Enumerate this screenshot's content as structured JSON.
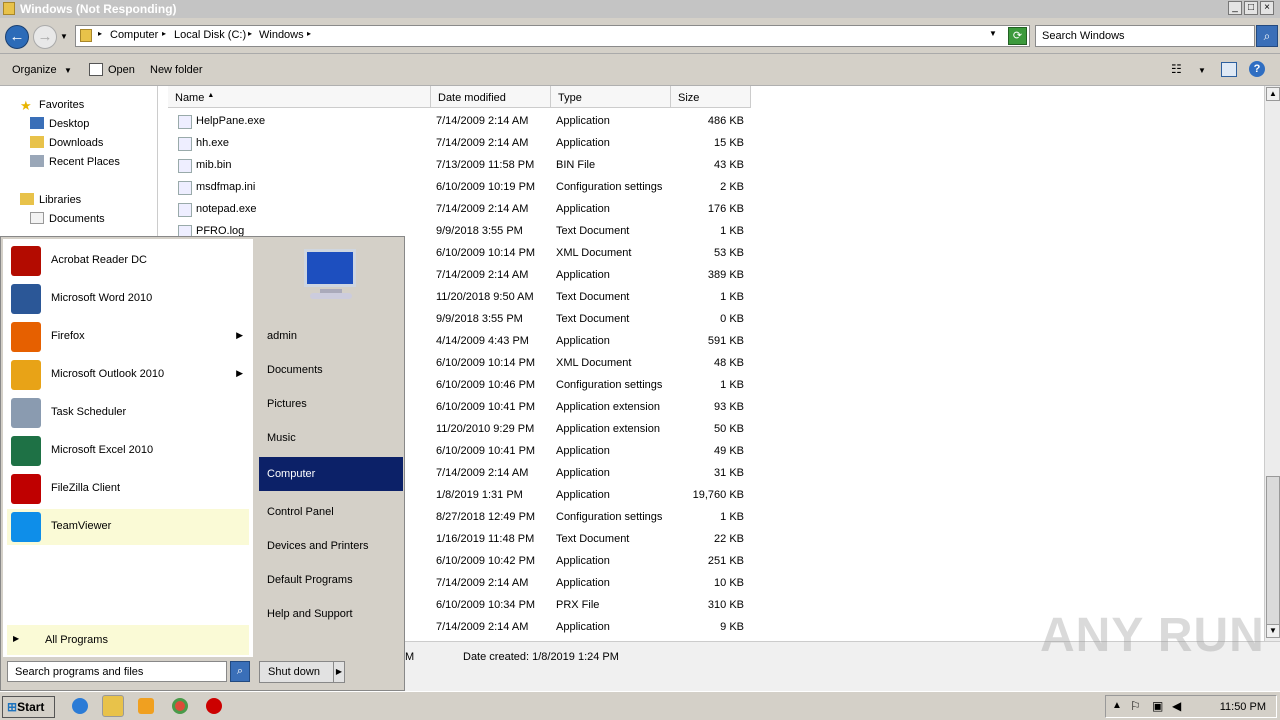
{
  "window": {
    "title": "Windows (Not Responding)",
    "min": "_",
    "max": "□",
    "close": "×"
  },
  "address": {
    "crumbs": [
      "Computer",
      "Local Disk (C:)",
      "Windows"
    ],
    "search_placeholder": "Search Windows"
  },
  "toolbar": {
    "organize": "Organize",
    "open": "Open",
    "new_folder": "New folder"
  },
  "nav": {
    "favorites": "Favorites",
    "desktop": "Desktop",
    "downloads": "Downloads",
    "recent": "Recent Places",
    "libraries": "Libraries",
    "documents": "Documents"
  },
  "columns": {
    "name": "Name",
    "date": "Date modified",
    "type": "Type",
    "size": "Size"
  },
  "files": [
    {
      "name": "HelpPane.exe",
      "date": "7/14/2009 2:14 AM",
      "type": "Application",
      "size": "486 KB"
    },
    {
      "name": "hh.exe",
      "date": "7/14/2009 2:14 AM",
      "type": "Application",
      "size": "15 KB"
    },
    {
      "name": "mib.bin",
      "date": "7/13/2009 11:58 PM",
      "type": "BIN File",
      "size": "43 KB"
    },
    {
      "name": "msdfmap.ini",
      "date": "6/10/2009 10:19 PM",
      "type": "Configuration settings",
      "size": "2 KB"
    },
    {
      "name": "notepad.exe",
      "date": "7/14/2009 2:14 AM",
      "type": "Application",
      "size": "176 KB"
    },
    {
      "name": "PFRO.log",
      "date": "9/9/2018 3:55 PM",
      "type": "Text Document",
      "size": "1 KB"
    },
    {
      "name": "",
      "date": "6/10/2009 10:14 PM",
      "type": "XML Document",
      "size": "53 KB"
    },
    {
      "name": "",
      "date": "7/14/2009 2:14 AM",
      "type": "Application",
      "size": "389 KB"
    },
    {
      "name": "",
      "date": "11/20/2018 9:50 AM",
      "type": "Text Document",
      "size": "1 KB"
    },
    {
      "name": "",
      "date": "9/9/2018 3:55 PM",
      "type": "Text Document",
      "size": "0 KB"
    },
    {
      "name": "",
      "date": "4/14/2009 4:43 PM",
      "type": "Application",
      "size": "591 KB"
    },
    {
      "name": "",
      "date": "6/10/2009 10:14 PM",
      "type": "XML Document",
      "size": "48 KB"
    },
    {
      "name": "",
      "date": "6/10/2009 10:46 PM",
      "type": "Configuration settings",
      "size": "1 KB"
    },
    {
      "name": "",
      "date": "6/10/2009 10:41 PM",
      "type": "Application extension",
      "size": "93 KB"
    },
    {
      "name": "",
      "date": "11/20/2010 9:29 PM",
      "type": "Application extension",
      "size": "50 KB"
    },
    {
      "name": "",
      "date": "6/10/2009 10:41 PM",
      "type": "Application",
      "size": "49 KB"
    },
    {
      "name": "",
      "date": "7/14/2009 2:14 AM",
      "type": "Application",
      "size": "31 KB"
    },
    {
      "name": "",
      "date": "1/8/2019 1:31 PM",
      "type": "Application",
      "size": "19,760 KB"
    },
    {
      "name": "",
      "date": "8/27/2018 12:49 PM",
      "type": "Configuration settings",
      "size": "1 KB"
    },
    {
      "name": "",
      "date": "1/16/2019 11:48 PM",
      "type": "Text Document",
      "size": "22 KB"
    },
    {
      "name": "",
      "date": "6/10/2009 10:42 PM",
      "type": "Application",
      "size": "251 KB"
    },
    {
      "name": "",
      "date": "7/14/2009 2:14 AM",
      "type": "Application",
      "size": "10 KB"
    },
    {
      "name": "",
      "date": "6/10/2009 10:34 PM",
      "type": "PRX File",
      "size": "310 KB"
    },
    {
      "name": "",
      "date": "7/14/2009 2:14 AM",
      "type": "Application",
      "size": "9 KB"
    }
  ],
  "details": {
    "partial": "M",
    "created": "Date created: 1/8/2019 1:24 PM"
  },
  "startmenu": {
    "programs": [
      {
        "label": "Acrobat Reader DC",
        "color": "#b30b00",
        "arrow": ""
      },
      {
        "label": "Microsoft Word 2010",
        "color": "#2b5797",
        "arrow": ""
      },
      {
        "label": "Firefox",
        "color": "#e66000",
        "arrow": "▶"
      },
      {
        "label": "Microsoft Outlook 2010",
        "color": "#e8a317",
        "arrow": "▶"
      },
      {
        "label": "Task Scheduler",
        "color": "#8a9bb0",
        "arrow": ""
      },
      {
        "label": "Microsoft Excel 2010",
        "color": "#1e7145",
        "arrow": ""
      },
      {
        "label": "FileZilla Client",
        "color": "#bf0000",
        "arrow": ""
      },
      {
        "label": "TeamViewer",
        "color": "#0e8ee9",
        "arrow": ""
      }
    ],
    "all_programs": "All Programs",
    "search_placeholder": "Search programs and files",
    "right": [
      "admin",
      "Documents",
      "Pictures",
      "Music",
      "Computer",
      "Control Panel",
      "Devices and Printers",
      "Default Programs",
      "Help and Support"
    ],
    "shutdown": "Shut down"
  },
  "taskbar": {
    "start": "Start",
    "clock": "11:50 PM"
  },
  "watermark": "ANY RUN"
}
